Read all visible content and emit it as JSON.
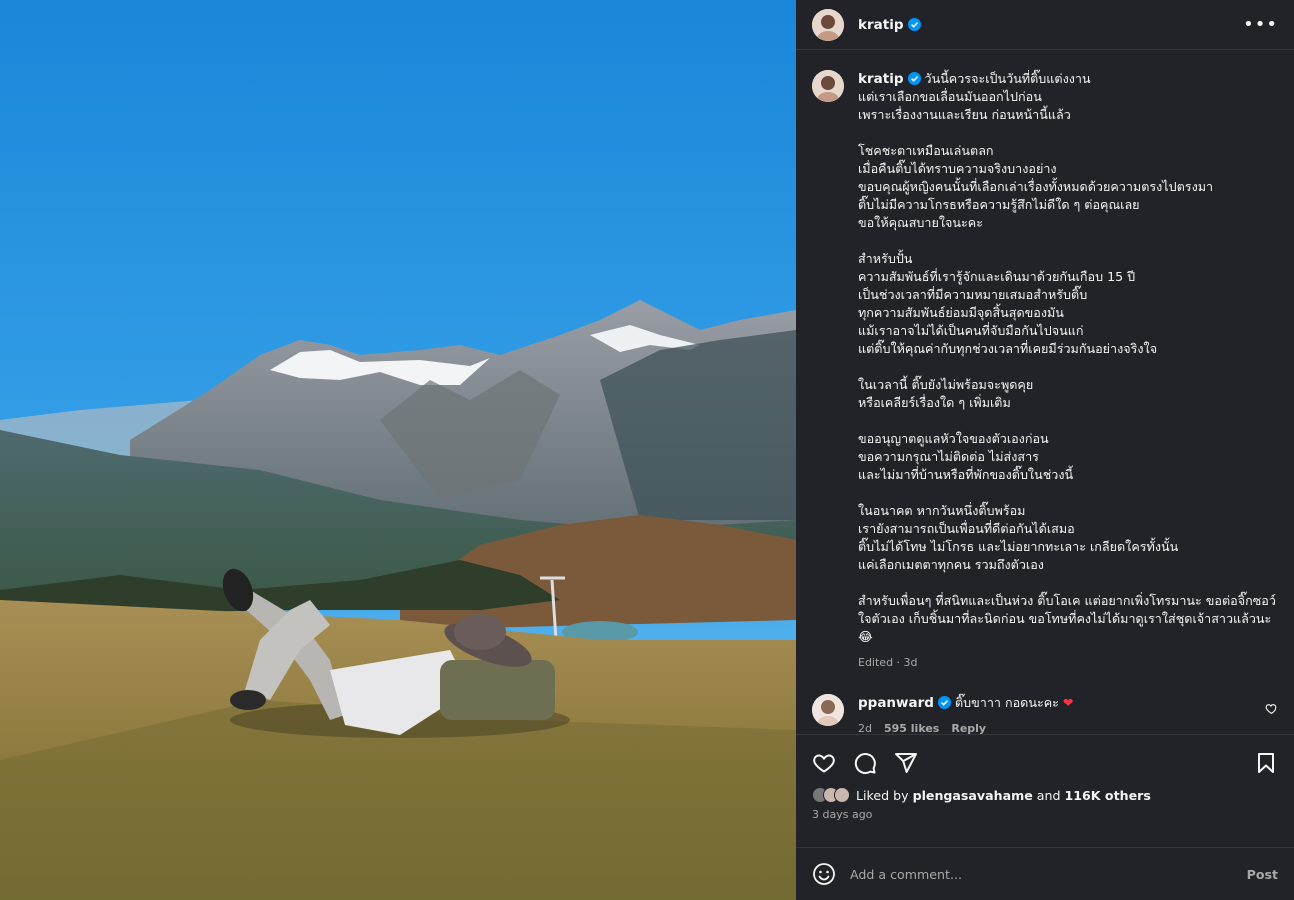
{
  "post": {
    "author": "kratip",
    "verified": true,
    "caption": "วันนี้ควรจะเป็นวันที่ติ๊บแต่งงาน\nแต่เราเลือกขอเลื่อนมันออกไปก่อน\nเพราะเรื่องงานและเรียน ก่อนหน้านี้แล้ว\n\nโชคชะตาเหมือนเล่นตลก\nเมื่อคืนติ๊บได้ทราบความจริงบางอย่าง\nขอบคุณผู้หญิงคนนั้นที่เลือกเล่าเรื่องทั้งหมดด้วยความตรงไปตรงมา\nติ๊บไม่มีความโกรธหรือความรู้สึกไม่ดีใด ๆ ต่อคุณเลย\nขอให้คุณสบายใจนะคะ\n\nสำหรับปั้น\nความสัมพันธ์ที่เรารู้จักและเดินมาด้วยกันเกือบ 15 ปี\nเป็นช่วงเวลาที่มีความหมายเสมอสำหรับติ๊บ\nทุกความสัมพันธ์ย่อมมีจุดสิ้นสุดของมัน\nแม้เราอาจไม่ได้เป็นคนที่จับมือกันไปจนแก่\nแต่ติ๊บให้คุณค่ากับทุกช่วงเวลาที่เคยมีร่วมกันอย่างจริงใจ\n\nในเวลานี้ ติ๊บยังไม่พร้อมจะพูดคุย\nหรือเคลียร์เรื่องใด ๆ เพิ่มเติม\n\nขออนุญาตดูแลหัวใจของตัวเองก่อน\nขอความกรุณาไม่ติดต่อ ไม่ส่งสาร\nและไม่มาที่บ้านหรือที่พักของติ๊บในช่วงนี้\n\nในอนาคต หากวันหนึ่งติ๊บพร้อม\nเรายังสามารถเป็นเพื่อนที่ดีต่อกันได้เสมอ\nติ๊บไม่ได้โทษ ไม่โกรธ และไม่อยากทะเลาะ เกลียดใครทั้งนั้น\nแค่เลือกเมตตาทุกคน รวมถึงตัวเอง\n\nสำหรับเพื่อนๆ ที่สนิทและเป็นห่วง ติ๊บโอเค แต่อยากเพิ่งโทรมานะ ขอต่อจิ๊กซอว์ ใจตัวเอง เก็บชิ้นมาที่ละนิดก่อน ขอโทษที่คงไม่ได้มาดูเราใส่ชุดเจ้าสาวแล้วนะ 😂",
    "edited": "Edited · 3d"
  },
  "comment": {
    "author": "ppanward",
    "text": "ติ๊บขาาา กอดนะคะ",
    "age": "2d",
    "likes": "595 likes",
    "reply": "Reply"
  },
  "likes": {
    "prefix": "Liked by",
    "user": "plengasavahame",
    "middle": "and",
    "others": "116K others",
    "time": "3 days ago"
  },
  "composer": {
    "placeholder": "Add a comment...",
    "post_label": "Post"
  },
  "icons": {
    "like": "heart-icon",
    "comment": "comment-icon",
    "share": "share-icon",
    "save": "bookmark-icon",
    "more": "more-icon",
    "emoji": "emoji-icon"
  },
  "colors": {
    "panel_bg": "#212328",
    "verified": "#0095f6",
    "heart_red": "#ff3040",
    "muted_text": "#a8a8a8"
  }
}
